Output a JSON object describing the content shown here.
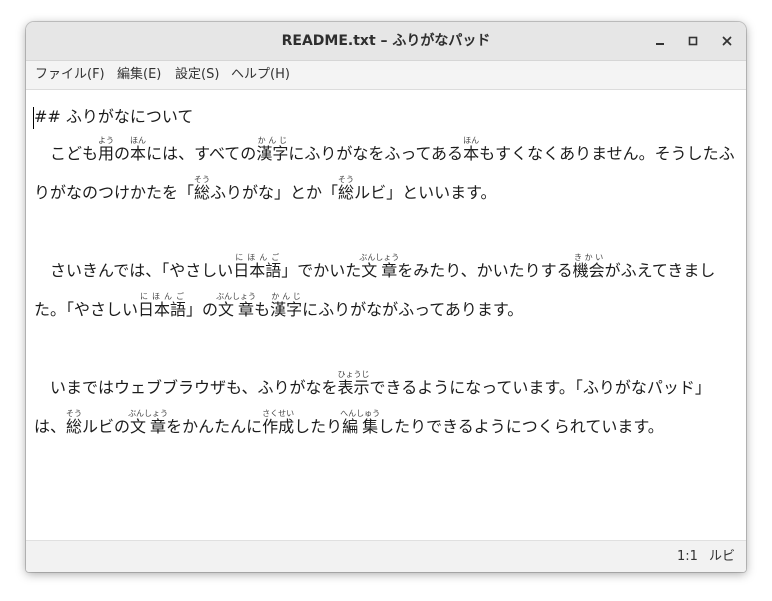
{
  "window": {
    "title": "README.txt – ふりがなパッド"
  },
  "menu": [
    "ファイル(F)",
    "編集(E)",
    "設定(S)",
    "ヘルプ(H)"
  ],
  "document": {
    "heading": "## ふりがなについて",
    "p1": {
      "a": "　こども",
      "r1": {
        "base": "用",
        "ruby": "よう"
      },
      "b": "の",
      "r2": {
        "base": "本",
        "ruby": "ほん"
      },
      "c": "には、すべての",
      "r3": {
        "base": "漢字",
        "ruby": "かんじ"
      },
      "d": "にふりがなをふってある",
      "r4": {
        "base": "本",
        "ruby": "ほん"
      },
      "e": "もすくなくありません。そうしたふ",
      "line2a": "りがなのつけかたを「",
      "r5": {
        "base": "総",
        "ruby": "そう"
      },
      "line2b": "ふりがな」とか「",
      "r6": {
        "base": "総",
        "ruby": "そう"
      },
      "line2c": "ルビ」といいます。"
    },
    "p2": {
      "a": "　さいきんでは、「やさしい",
      "r1": {
        "base": "日本語",
        "ruby": "にほんご"
      },
      "b": "」でかいた",
      "r2": {
        "base": "文章",
        "ruby": "ぶんしょう"
      },
      "c": "をみたり、かいたりする",
      "r3": {
        "base": "機会",
        "ruby": "きかい"
      },
      "d": "がふえてきまし",
      "line2a": "た。「やさしい",
      "r4": {
        "base": "日本語",
        "ruby": "にほんご"
      },
      "line2b": "」の",
      "r5": {
        "base": "文章",
        "ruby": "ぶんしょう"
      },
      "line2c": "も",
      "r6": {
        "base": "漢字",
        "ruby": "かんじ"
      },
      "line2d": "にふりがながふってあります。"
    },
    "p3": {
      "a": "　いまではウェブブラウザも、ふりがなを",
      "r1": {
        "base": "表示",
        "ruby": "ひょうじ"
      },
      "b": "できるようになっています。「ふりがなパッド」",
      "line2a": "は、",
      "r2": {
        "base": "総",
        "ruby": "そう"
      },
      "line2b": "ルビの",
      "r3": {
        "base": "文章",
        "ruby": "ぶんしょう"
      },
      "line2c": "をかんたんに",
      "r4": {
        "base": "作成",
        "ruby": "さくせい"
      },
      "line2d": "したり",
      "r5": {
        "base": "編集",
        "ruby": "へんしゅう"
      },
      "line2e": "したりできるようにつくられています。"
    }
  },
  "status": {
    "position": "1:1",
    "mode": "ルビ"
  },
  "icons": {
    "minimize": "minimize-icon",
    "maximize": "maximize-icon",
    "close": "close-icon"
  }
}
